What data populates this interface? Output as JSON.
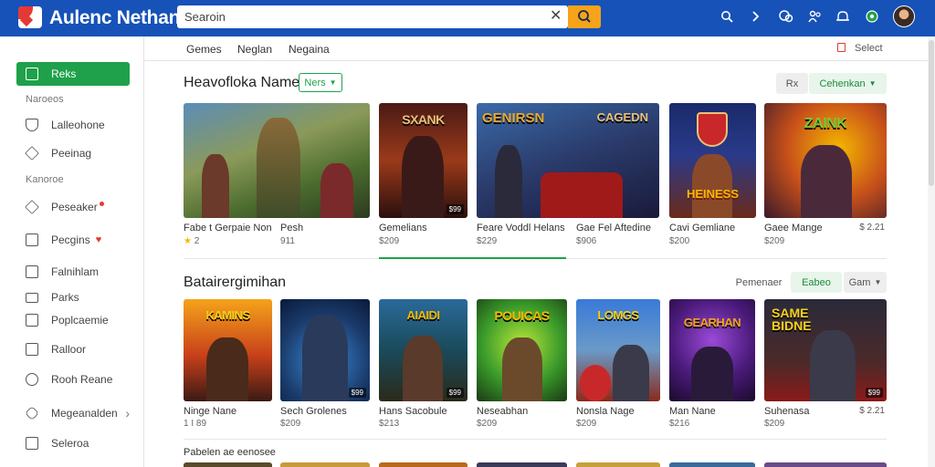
{
  "header": {
    "app_title": "Aulenc Nethan",
    "search_placeholder": "Searoin",
    "clear_icon": "close-icon",
    "search_icon": "search-icon",
    "top_icons": [
      "search-icon",
      "chevron-right-icon",
      "controller-icon",
      "people-icon",
      "bell-icon",
      "globe-icon"
    ]
  },
  "sidebar": {
    "items": [
      {
        "label": "Reks",
        "icon": "store-icon",
        "active": true
      },
      {
        "label": "Lalleohone",
        "icon": "shield-icon"
      },
      {
        "label": "Peeinag",
        "icon": "pencil-icon"
      },
      {
        "label": "Peseaker",
        "icon": "tag-icon",
        "badge": true
      },
      {
        "label": "Pecgins",
        "icon": "list-icon",
        "heart": true
      },
      {
        "label": "Falnihlam",
        "icon": "grid-icon"
      },
      {
        "label": "Parks",
        "icon": "folder-icon"
      },
      {
        "label": "Poplcaemie",
        "icon": "doc-icon"
      },
      {
        "label": "Ralloor",
        "icon": "box-icon"
      },
      {
        "label": "Rooh Reane",
        "icon": "clock-icon"
      },
      {
        "label": "Megeanalden",
        "icon": "link-icon",
        "chevron": true
      },
      {
        "label": "Seleroa",
        "icon": "square-icon"
      }
    ],
    "sections": [
      "Naroeos",
      "Kanoroe"
    ]
  },
  "subnav": {
    "tabs": [
      "Gemes",
      "Neglan",
      "Negaina"
    ],
    "select_label": "Select"
  },
  "section1": {
    "title": "Heavofloka Name",
    "filter_label": "Ners",
    "btn_left": "Rx",
    "btn_right": "Cehenkan",
    "cards": [
      {
        "name": "Fabe t Gerpaie Non",
        "price": "",
        "rating_text": "2",
        "art": "#3d5a2a",
        "logo": "",
        "badge": "",
        "star": true
      },
      {
        "name": "Pesh",
        "price": "911",
        "logo": "",
        "badge": ""
      },
      {
        "name": "Gemelians",
        "price": "$209",
        "logo": "SXANK",
        "badge": "$99"
      },
      {
        "name": "Feare Voddl Helans",
        "price": "$229",
        "logo": "GENIRSN",
        "logo2": "CAGEDN",
        "badge": ""
      },
      {
        "name": "Gae Fel Aftedine",
        "price": "$906",
        "logo": "",
        "badge": ""
      },
      {
        "name": "Cavi Gemliane",
        "price": "$200",
        "logo": "HEINESS",
        "badge": ""
      },
      {
        "name": "Gaee Mange",
        "price": "$209",
        "rating": "$ 2.21",
        "logo": "ZAINK",
        "badge": ""
      }
    ]
  },
  "section2": {
    "title": "Batairergimihan",
    "sort_label": "Pemenaer",
    "btn_active": "Eabeo",
    "btn_dropdown": "Gam",
    "cards": [
      {
        "name": "Ninge Nane",
        "price": "1 I 89",
        "logo": "KAMINS",
        "badge": ""
      },
      {
        "name": "Sech Grolenes",
        "price": "$209",
        "logo": "",
        "badge": "$99"
      },
      {
        "name": "Hans Sacobule",
        "price": "$213",
        "logo": "AIAIDI",
        "badge": "$99"
      },
      {
        "name": "Neseabhan",
        "price": "$209",
        "logo": "POUICAS",
        "badge": ""
      },
      {
        "name": "Nonsla Nage",
        "price": "$209",
        "logo": "LOMGS",
        "badge": ""
      },
      {
        "name": "Man Nane",
        "price": "$216",
        "logo": "GEARHAN",
        "badge": ""
      },
      {
        "name": "Suhenasa",
        "price": "$209",
        "rating": "$ 2.21",
        "logo": "SAME",
        "logo2": "BIDNE",
        "badge": "$99"
      }
    ]
  },
  "section3": {
    "title": "Pabelen ae eenosee"
  },
  "colors": {
    "topbar": "#1652b8",
    "accent": "#1ea14a",
    "search_button": "#f5a31b"
  }
}
